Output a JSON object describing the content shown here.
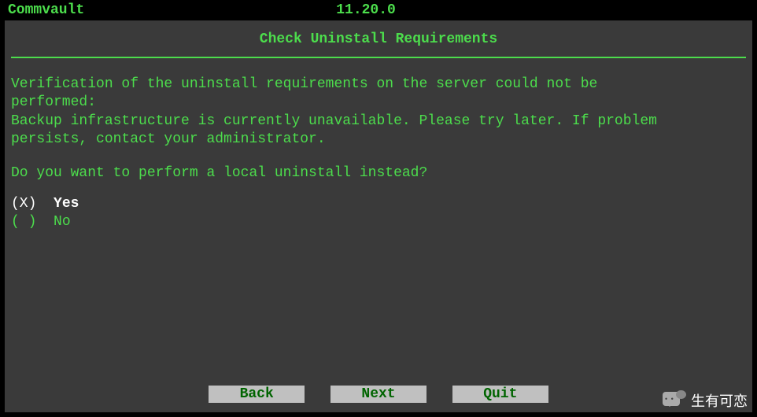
{
  "header": {
    "appName": "Commvault",
    "version": "11.20.0"
  },
  "title": "Check Uninstall Requirements",
  "message": "Verification of the uninstall requirements on the server could not be\nperformed:\nBackup infrastructure is currently unavailable. Please try later. If problem\npersists, contact your administrator.",
  "question": "Do you want to perform a local uninstall instead?",
  "options": {
    "yes": {
      "marker": "(X)",
      "label": "Yes"
    },
    "no": {
      "marker": "( )",
      "label": "No"
    }
  },
  "buttons": {
    "back": "Back",
    "next": "Next",
    "quit": "Quit"
  },
  "watermark": "生有可恋"
}
